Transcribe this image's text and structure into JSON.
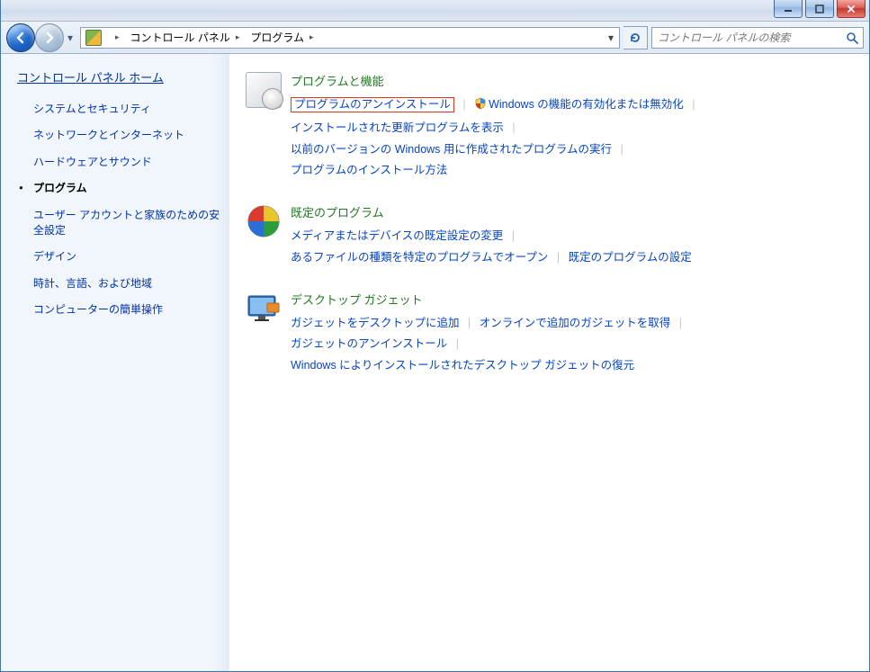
{
  "breadcrumb": {
    "root_icon": "control-panel",
    "level1": "コントロール パネル",
    "level2": "プログラム"
  },
  "search": {
    "placeholder": "コントロール パネルの検索"
  },
  "sidebar": {
    "home": "コントロール パネル ホーム",
    "items": [
      "システムとセキュリティ",
      "ネットワークとインターネット",
      "ハードウェアとサウンド",
      "プログラム",
      "ユーザー アカウントと家族のための安全設定",
      "デザイン",
      "時計、言語、および地域",
      "コンピューターの簡単操作"
    ],
    "current_index": 3
  },
  "sections": [
    {
      "icon": "programs",
      "heading": "プログラムと機能",
      "links": [
        {
          "text": "プログラムのアンインストール",
          "highlighted": true
        },
        {
          "text": "Windows の機能の有効化または無効化",
          "shield": true
        },
        {
          "text": "インストールされた更新プログラムを表示"
        },
        {
          "text": "以前のバージョンの Windows 用に作成されたプログラムの実行"
        },
        {
          "text": "プログラムのインストール方法"
        }
      ]
    },
    {
      "icon": "defaults",
      "heading": "既定のプログラム",
      "links": [
        {
          "text": "メディアまたはデバイスの既定設定の変更"
        },
        {
          "text": "あるファイルの種類を特定のプログラムでオープン"
        },
        {
          "text": "既定のプログラムの設定"
        }
      ]
    },
    {
      "icon": "gadgets",
      "heading": "デスクトップ ガジェット",
      "links": [
        {
          "text": "ガジェットをデスクトップに追加"
        },
        {
          "text": "オンラインで追加のガジェットを取得"
        },
        {
          "text": "ガジェットのアンインストール"
        },
        {
          "text": "Windows によりインストールされたデスクトップ ガジェットの復元"
        }
      ]
    }
  ]
}
